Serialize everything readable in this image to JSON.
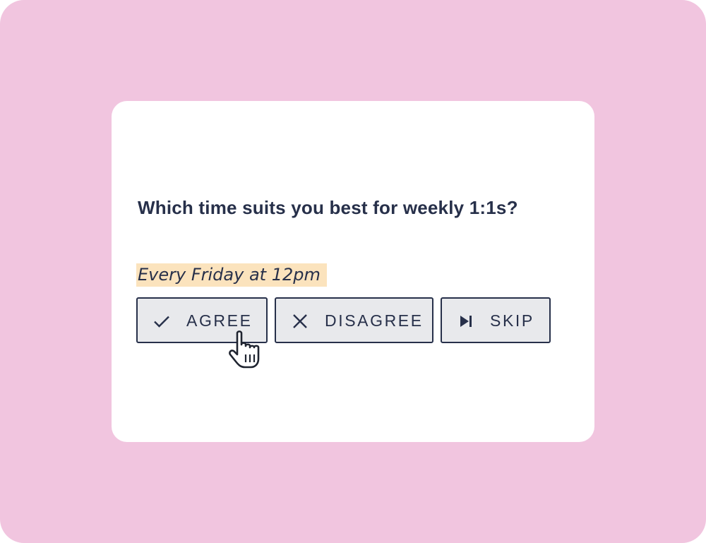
{
  "colors": {
    "background": "#f1c5df",
    "card": "#ffffff",
    "text": "#27304a",
    "highlight": "#fbe3bd",
    "button_fill": "#e8e9ec",
    "button_border": "#27304a"
  },
  "question": {
    "text": "Which time suits you best for weekly 1:1s?"
  },
  "answer": {
    "text": "Every Friday at 12pm"
  },
  "buttons": {
    "agree": {
      "label": "AGREE",
      "icon": "checkmark-icon"
    },
    "disagree": {
      "label": "DISAGREE",
      "icon": "x-icon"
    },
    "skip": {
      "label": "SKIP",
      "icon": "skip-next-icon"
    }
  },
  "cursor": {
    "icon": "hand-pointer-cursor-icon",
    "hovering": "agree"
  }
}
